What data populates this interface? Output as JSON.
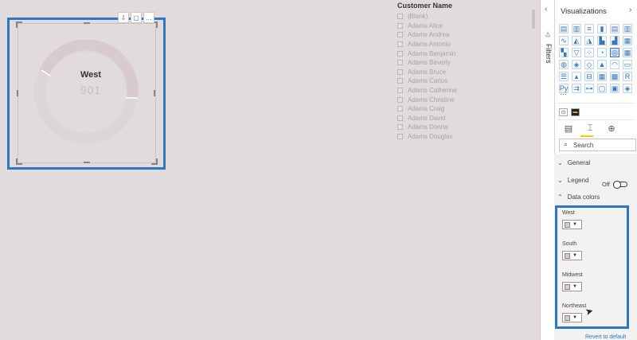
{
  "donut": {
    "category": "West",
    "value": "901",
    "colors": {
      "ring": "#dcd6d7",
      "segment": "#d7cbcd",
      "gap": "#ffffff"
    }
  },
  "slicer": {
    "title": "Customer Name",
    "items": [
      "(Blank)",
      "Adams Alice",
      "Adams Andrea",
      "Adams Antonio",
      "Adams Benjamin",
      "Adams Beverly",
      "Adams Bruce",
      "Adams Carlos",
      "Adams Catherine",
      "Adams Christine",
      "Adams Craig",
      "Adams David",
      "Adams Donna",
      "Adams Douglas"
    ]
  },
  "filters": {
    "label": "Filters"
  },
  "pane": {
    "title": "Visualizations",
    "more": "···",
    "search_placeholder": "Search",
    "sections": {
      "general": "General",
      "legend": "Legend",
      "legend_state": "Off",
      "data_colors": "Data colors"
    },
    "data_colors": [
      {
        "name": "West"
      },
      {
        "name": "South"
      },
      {
        "name": "Midwest"
      },
      {
        "name": "Northeast"
      }
    ],
    "revert": "Revert to default",
    "accent": "#2b78c5",
    "tab_accent": "#f2c811"
  }
}
